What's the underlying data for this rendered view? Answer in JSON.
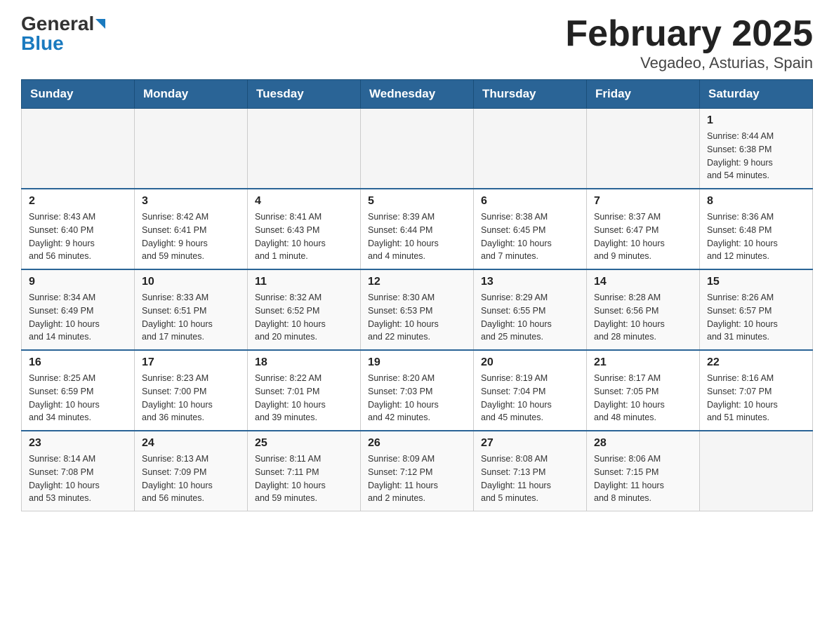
{
  "logo": {
    "general": "General",
    "blue": "Blue"
  },
  "title": "February 2025",
  "subtitle": "Vegadeo, Asturias, Spain",
  "weekdays": [
    "Sunday",
    "Monday",
    "Tuesday",
    "Wednesday",
    "Thursday",
    "Friday",
    "Saturday"
  ],
  "weeks": [
    [
      {
        "day": "",
        "info": ""
      },
      {
        "day": "",
        "info": ""
      },
      {
        "day": "",
        "info": ""
      },
      {
        "day": "",
        "info": ""
      },
      {
        "day": "",
        "info": ""
      },
      {
        "day": "",
        "info": ""
      },
      {
        "day": "1",
        "info": "Sunrise: 8:44 AM\nSunset: 6:38 PM\nDaylight: 9 hours\nand 54 minutes."
      }
    ],
    [
      {
        "day": "2",
        "info": "Sunrise: 8:43 AM\nSunset: 6:40 PM\nDaylight: 9 hours\nand 56 minutes."
      },
      {
        "day": "3",
        "info": "Sunrise: 8:42 AM\nSunset: 6:41 PM\nDaylight: 9 hours\nand 59 minutes."
      },
      {
        "day": "4",
        "info": "Sunrise: 8:41 AM\nSunset: 6:43 PM\nDaylight: 10 hours\nand 1 minute."
      },
      {
        "day": "5",
        "info": "Sunrise: 8:39 AM\nSunset: 6:44 PM\nDaylight: 10 hours\nand 4 minutes."
      },
      {
        "day": "6",
        "info": "Sunrise: 8:38 AM\nSunset: 6:45 PM\nDaylight: 10 hours\nand 7 minutes."
      },
      {
        "day": "7",
        "info": "Sunrise: 8:37 AM\nSunset: 6:47 PM\nDaylight: 10 hours\nand 9 minutes."
      },
      {
        "day": "8",
        "info": "Sunrise: 8:36 AM\nSunset: 6:48 PM\nDaylight: 10 hours\nand 12 minutes."
      }
    ],
    [
      {
        "day": "9",
        "info": "Sunrise: 8:34 AM\nSunset: 6:49 PM\nDaylight: 10 hours\nand 14 minutes."
      },
      {
        "day": "10",
        "info": "Sunrise: 8:33 AM\nSunset: 6:51 PM\nDaylight: 10 hours\nand 17 minutes."
      },
      {
        "day": "11",
        "info": "Sunrise: 8:32 AM\nSunset: 6:52 PM\nDaylight: 10 hours\nand 20 minutes."
      },
      {
        "day": "12",
        "info": "Sunrise: 8:30 AM\nSunset: 6:53 PM\nDaylight: 10 hours\nand 22 minutes."
      },
      {
        "day": "13",
        "info": "Sunrise: 8:29 AM\nSunset: 6:55 PM\nDaylight: 10 hours\nand 25 minutes."
      },
      {
        "day": "14",
        "info": "Sunrise: 8:28 AM\nSunset: 6:56 PM\nDaylight: 10 hours\nand 28 minutes."
      },
      {
        "day": "15",
        "info": "Sunrise: 8:26 AM\nSunset: 6:57 PM\nDaylight: 10 hours\nand 31 minutes."
      }
    ],
    [
      {
        "day": "16",
        "info": "Sunrise: 8:25 AM\nSunset: 6:59 PM\nDaylight: 10 hours\nand 34 minutes."
      },
      {
        "day": "17",
        "info": "Sunrise: 8:23 AM\nSunset: 7:00 PM\nDaylight: 10 hours\nand 36 minutes."
      },
      {
        "day": "18",
        "info": "Sunrise: 8:22 AM\nSunset: 7:01 PM\nDaylight: 10 hours\nand 39 minutes."
      },
      {
        "day": "19",
        "info": "Sunrise: 8:20 AM\nSunset: 7:03 PM\nDaylight: 10 hours\nand 42 minutes."
      },
      {
        "day": "20",
        "info": "Sunrise: 8:19 AM\nSunset: 7:04 PM\nDaylight: 10 hours\nand 45 minutes."
      },
      {
        "day": "21",
        "info": "Sunrise: 8:17 AM\nSunset: 7:05 PM\nDaylight: 10 hours\nand 48 minutes."
      },
      {
        "day": "22",
        "info": "Sunrise: 8:16 AM\nSunset: 7:07 PM\nDaylight: 10 hours\nand 51 minutes."
      }
    ],
    [
      {
        "day": "23",
        "info": "Sunrise: 8:14 AM\nSunset: 7:08 PM\nDaylight: 10 hours\nand 53 minutes."
      },
      {
        "day": "24",
        "info": "Sunrise: 8:13 AM\nSunset: 7:09 PM\nDaylight: 10 hours\nand 56 minutes."
      },
      {
        "day": "25",
        "info": "Sunrise: 8:11 AM\nSunset: 7:11 PM\nDaylight: 10 hours\nand 59 minutes."
      },
      {
        "day": "26",
        "info": "Sunrise: 8:09 AM\nSunset: 7:12 PM\nDaylight: 11 hours\nand 2 minutes."
      },
      {
        "day": "27",
        "info": "Sunrise: 8:08 AM\nSunset: 7:13 PM\nDaylight: 11 hours\nand 5 minutes."
      },
      {
        "day": "28",
        "info": "Sunrise: 8:06 AM\nSunset: 7:15 PM\nDaylight: 11 hours\nand 8 minutes."
      },
      {
        "day": "",
        "info": ""
      }
    ]
  ]
}
